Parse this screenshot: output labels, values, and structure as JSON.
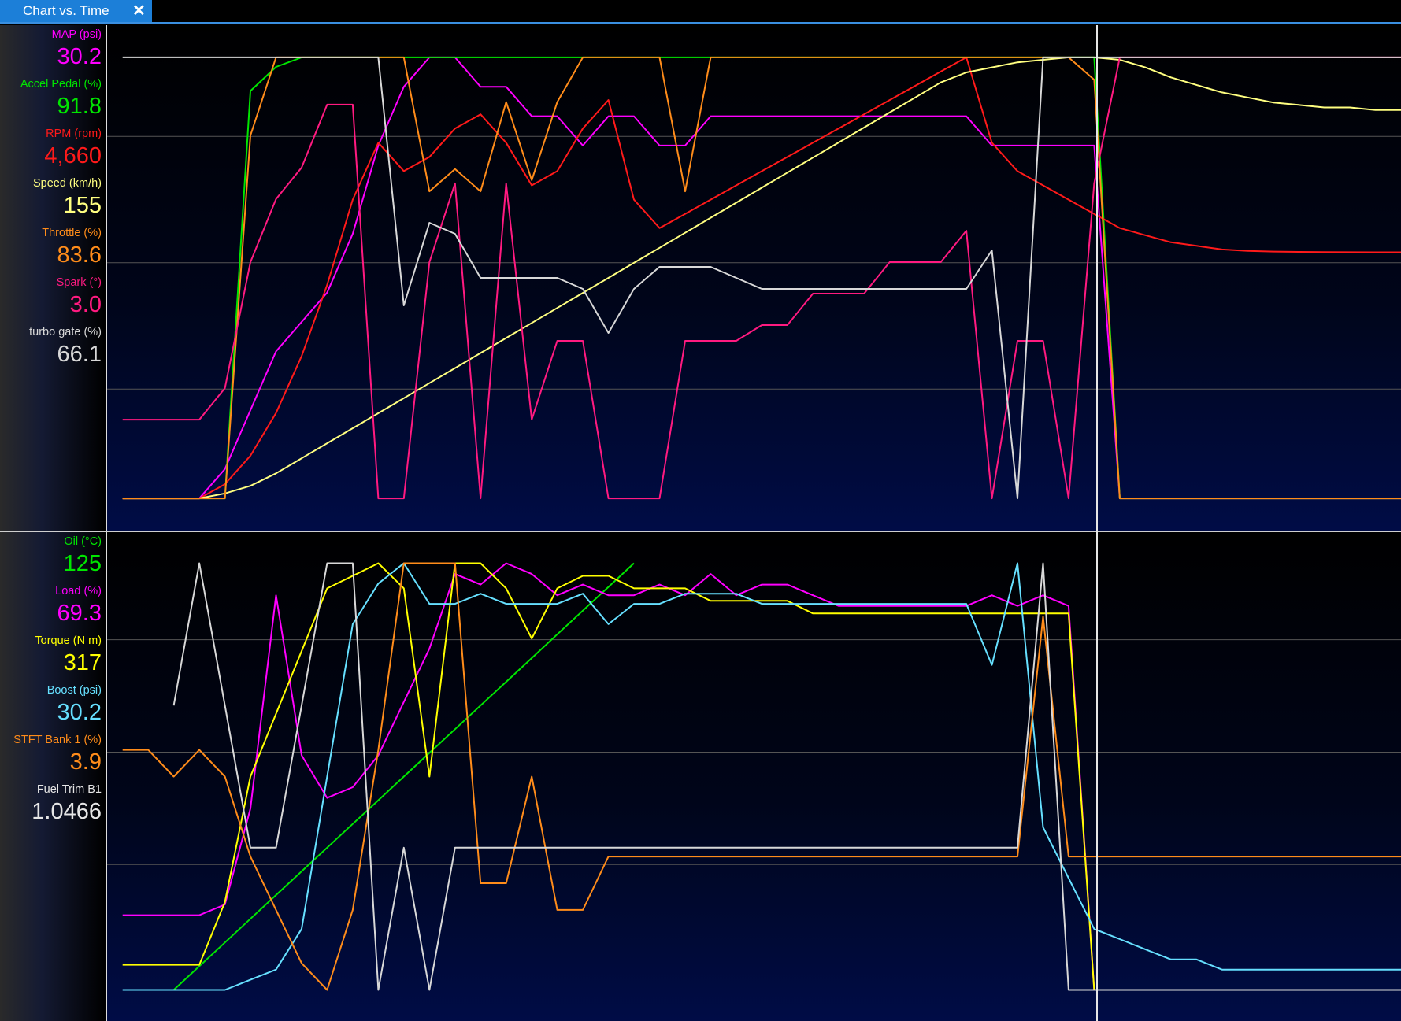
{
  "window": {
    "tab_title": "Chart vs. Time",
    "close_glyph": "✕"
  },
  "top_pane": {
    "legend": [
      {
        "label": "MAP (psi)",
        "value": "30.2",
        "color": "#ff00ff"
      },
      {
        "label": "Accel Pedal (%)",
        "value": "91.8",
        "color": "#00e600"
      },
      {
        "label": "RPM (rpm)",
        "value": "4,660",
        "color": "#ff1a1a"
      },
      {
        "label": "Speed (km/h)",
        "value": "155",
        "color": "#ffff80"
      },
      {
        "label": "Throttle (%)",
        "value": "83.6",
        "color": "#ff8c1a"
      },
      {
        "label": "Spark (°)",
        "value": "3.0",
        "color": "#ff1a80"
      },
      {
        "label": "turbo gate (%)",
        "value": "66.1",
        "color": "#d8d8d8"
      }
    ]
  },
  "bottom_pane": {
    "legend": [
      {
        "label": "Oil (°C)",
        "value": "125",
        "color": "#00e600"
      },
      {
        "label": "Load (%)",
        "value": "69.3",
        "color": "#ff00ff"
      },
      {
        "label": "Torque (N m)",
        "value": "317",
        "color": "#ffff00"
      },
      {
        "label": "Boost (psi)",
        "value": "30.2",
        "color": "#66e0ff"
      },
      {
        "label": "STFT Bank 1 (%)",
        "value": "3.9",
        "color": "#ff8c1a"
      },
      {
        "label": "Fuel Trim B1",
        "value": "1.0466",
        "color": "#e6e6e6"
      }
    ]
  },
  "chart_data": [
    {
      "type": "line",
      "title": "",
      "x": [
        0,
        2,
        4,
        6,
        8,
        10,
        12,
        14,
        16,
        18,
        20,
        22,
        24,
        26,
        28,
        30,
        32,
        34,
        36,
        38,
        40,
        42,
        44,
        46,
        48,
        50,
        52,
        54,
        56,
        58,
        60,
        62,
        64,
        66,
        68,
        70,
        72,
        74,
        76,
        78,
        80,
        82,
        84,
        86,
        88,
        90,
        92,
        94,
        96,
        98,
        100
      ],
      "grid": true,
      "cursor_x": 76.5,
      "series": [
        {
          "name": "MAP (psi)",
          "color": "#ff00ff",
          "values": [
            14,
            14,
            14,
            14,
            15,
            17,
            19,
            20,
            21,
            23,
            26,
            28,
            29,
            29,
            28,
            28,
            27,
            27,
            26,
            27,
            27,
            26,
            26,
            27,
            27,
            27,
            27,
            27,
            27,
            27,
            27,
            27,
            27,
            27,
            26,
            26,
            26,
            26,
            26,
            14,
            14,
            14,
            14,
            14,
            14,
            14,
            14,
            14,
            14,
            14,
            14
          ]
        },
        {
          "name": "Accel Pedal (%)",
          "color": "#00e600",
          "values": [
            0,
            0,
            0,
            0,
            0,
            85,
            90,
            92,
            92,
            92,
            92,
            92,
            92,
            92,
            92,
            92,
            92,
            92,
            92,
            92,
            92,
            92,
            92,
            92,
            92,
            92,
            92,
            92,
            92,
            92,
            92,
            92,
            92,
            92,
            92,
            92,
            92,
            92,
            92,
            0,
            0,
            0,
            0,
            0,
            0,
            0,
            0,
            0,
            0,
            0,
            0
          ]
        },
        {
          "name": "RPM (rpm)",
          "color": "#ff1a1a",
          "values": [
            1200,
            1200,
            1200,
            1200,
            1400,
            1800,
            2400,
            3200,
            4200,
            5400,
            6200,
            5800,
            6000,
            6400,
            6600,
            6200,
            5600,
            5800,
            6400,
            6800,
            5400,
            5000,
            5200,
            5400,
            5600,
            5800,
            6000,
            6200,
            6400,
            6600,
            6800,
            7000,
            7200,
            7400,
            6200,
            5800,
            5600,
            5400,
            5200,
            5000,
            4900,
            4800,
            4750,
            4700,
            4680,
            4670,
            4665,
            4662,
            4661,
            4660,
            4660
          ]
        },
        {
          "name": "Speed (km/h)",
          "color": "#ffff80",
          "values": [
            0,
            0,
            0,
            0,
            2,
            5,
            10,
            16,
            22,
            28,
            34,
            40,
            46,
            52,
            58,
            64,
            70,
            76,
            82,
            88,
            94,
            100,
            106,
            112,
            118,
            124,
            130,
            136,
            142,
            148,
            154,
            160,
            166,
            170,
            172,
            174,
            175,
            176,
            176,
            175,
            172,
            168,
            165,
            162,
            160,
            158,
            157,
            156,
            156,
            155,
            155
          ]
        },
        {
          "name": "Throttle (%)",
          "color": "#ff8c1a",
          "values": [
            5,
            5,
            5,
            5,
            5,
            70,
            84,
            84,
            84,
            84,
            84,
            84,
            60,
            64,
            60,
            76,
            62,
            76,
            84,
            84,
            84,
            84,
            60,
            84,
            84,
            84,
            84,
            84,
            84,
            84,
            84,
            84,
            84,
            84,
            84,
            84,
            84,
            84,
            80,
            5,
            5,
            5,
            5,
            5,
            5,
            5,
            5,
            5,
            5,
            5,
            5
          ]
        },
        {
          "name": "Spark (°)",
          "color": "#ff1a80",
          "values": [
            -20,
            -20,
            -20,
            -20,
            -18,
            -10,
            -6,
            -4,
            0,
            0,
            -25,
            -25,
            -10,
            -5,
            -25,
            -5,
            -20,
            -15,
            -15,
            -25,
            -25,
            -25,
            -15,
            -15,
            -15,
            -14,
            -14,
            -12,
            -12,
            -12,
            -10,
            -10,
            -10,
            -8,
            -25,
            -15,
            -15,
            -25,
            -5,
            3,
            3,
            3,
            3,
            3,
            3,
            3,
            3,
            3,
            3,
            3,
            3
          ]
        },
        {
          "name": "turbo gate (%)",
          "color": "#d8d8d8",
          "values": [
            100,
            100,
            100,
            100,
            100,
            100,
            100,
            100,
            100,
            100,
            100,
            55,
            70,
            68,
            60,
            60,
            60,
            60,
            58,
            50,
            58,
            62,
            62,
            62,
            60,
            58,
            58,
            58,
            58,
            58,
            58,
            58,
            58,
            58,
            65,
            20,
            100,
            100,
            100,
            100,
            100,
            100,
            100,
            100,
            100,
            100,
            100,
            100,
            100,
            100,
            100
          ]
        }
      ]
    },
    {
      "type": "line",
      "title": "",
      "x": [
        0,
        2,
        4,
        6,
        8,
        10,
        12,
        14,
        16,
        18,
        20,
        22,
        24,
        26,
        28,
        30,
        32,
        34,
        36,
        38,
        40,
        42,
        44,
        46,
        48,
        50,
        52,
        54,
        56,
        58,
        60,
        62,
        64,
        66,
        68,
        70,
        72,
        74,
        76,
        78,
        80,
        82,
        84,
        86,
        88,
        90,
        92,
        94,
        96,
        98,
        100
      ],
      "grid": true,
      "cursor_x": 76.5,
      "series": [
        {
          "name": "Oil (°C)",
          "color": "#00e600",
          "values": [
            null,
            null,
            110,
            111,
            112,
            113,
            114,
            115,
            116,
            117,
            118,
            119,
            120,
            121,
            122,
            123,
            124,
            125,
            126,
            127,
            128,
            null,
            null,
            null,
            null,
            null,
            null,
            null,
            null,
            null,
            null,
            null,
            null,
            null,
            null,
            null,
            null,
            null,
            null,
            null,
            null,
            null,
            null,
            null,
            null,
            null,
            null,
            null,
            null,
            null,
            null
          ]
        },
        {
          "name": "Load (%)",
          "color": "#ff00ff",
          "values": [
            20,
            20,
            20,
            20,
            22,
            40,
            80,
            50,
            42,
            44,
            50,
            60,
            70,
            84,
            82,
            86,
            84,
            80,
            82,
            80,
            80,
            82,
            80,
            84,
            80,
            82,
            82,
            80,
            78,
            78,
            78,
            78,
            78,
            78,
            80,
            78,
            80,
            78,
            6,
            6,
            6,
            6,
            6,
            6,
            6,
            6,
            6,
            6,
            6,
            6,
            6
          ]
        },
        {
          "name": "Torque (N m)",
          "color": "#ffff00",
          "values": [
            10,
            10,
            10,
            10,
            20,
            40,
            50,
            60,
            70,
            72,
            74,
            70,
            40,
            74,
            74,
            70,
            62,
            70,
            72,
            72,
            70,
            70,
            70,
            68,
            68,
            68,
            68,
            66,
            66,
            66,
            66,
            66,
            66,
            66,
            66,
            66,
            66,
            66,
            6,
            6,
            6,
            6,
            6,
            6,
            6,
            6,
            6,
            6,
            6,
            6,
            6
          ]
        },
        {
          "name": "Boost (psi)",
          "color": "#66e0ff",
          "values": [
            24,
            24,
            24,
            24,
            24,
            25,
            26,
            30,
            45,
            60,
            64,
            66,
            62,
            62,
            63,
            62,
            62,
            62,
            63,
            60,
            62,
            62,
            63,
            63,
            63,
            62,
            62,
            62,
            62,
            62,
            62,
            62,
            62,
            62,
            56,
            66,
            40,
            35,
            30,
            29,
            28,
            27,
            27,
            26,
            26,
            26,
            26,
            26,
            26,
            26,
            26
          ]
        },
        {
          "name": "STFT Bank 1 (%)",
          "color": "#ff8c1a",
          "values": [
            3,
            3,
            2,
            3,
            2,
            -1,
            -3,
            -5,
            -6,
            -3,
            3,
            10,
            10,
            10,
            -2,
            -2,
            2,
            -3,
            -3,
            -1,
            -1,
            -1,
            -1,
            -1,
            -1,
            -1,
            -1,
            -1,
            -1,
            -1,
            -1,
            -1,
            -1,
            -1,
            -1,
            -1,
            8,
            -1,
            -1,
            -1,
            -1,
            -1,
            -1,
            -1,
            -1,
            -1,
            -1,
            -1,
            -1,
            -1,
            -1
          ]
        },
        {
          "name": "Fuel Trim B1",
          "color": "#d8d8d8",
          "values": [
            null,
            null,
            1.04,
            1.045,
            1.04,
            1.035,
            1.035,
            1.04,
            1.045,
            1.045,
            1.03,
            1.035,
            1.03,
            1.035,
            1.035,
            1.035,
            1.035,
            1.035,
            1.035,
            1.035,
            1.035,
            1.035,
            1.035,
            1.035,
            1.035,
            1.035,
            1.035,
            1.035,
            1.035,
            1.035,
            1.035,
            1.035,
            1.035,
            1.035,
            1.035,
            1.035,
            1.045,
            1.03,
            1.03,
            1.03,
            1.03,
            1.03,
            1.03,
            1.03,
            1.03,
            1.03,
            1.03,
            1.03,
            1.03,
            1.03,
            1.03
          ]
        }
      ]
    }
  ]
}
